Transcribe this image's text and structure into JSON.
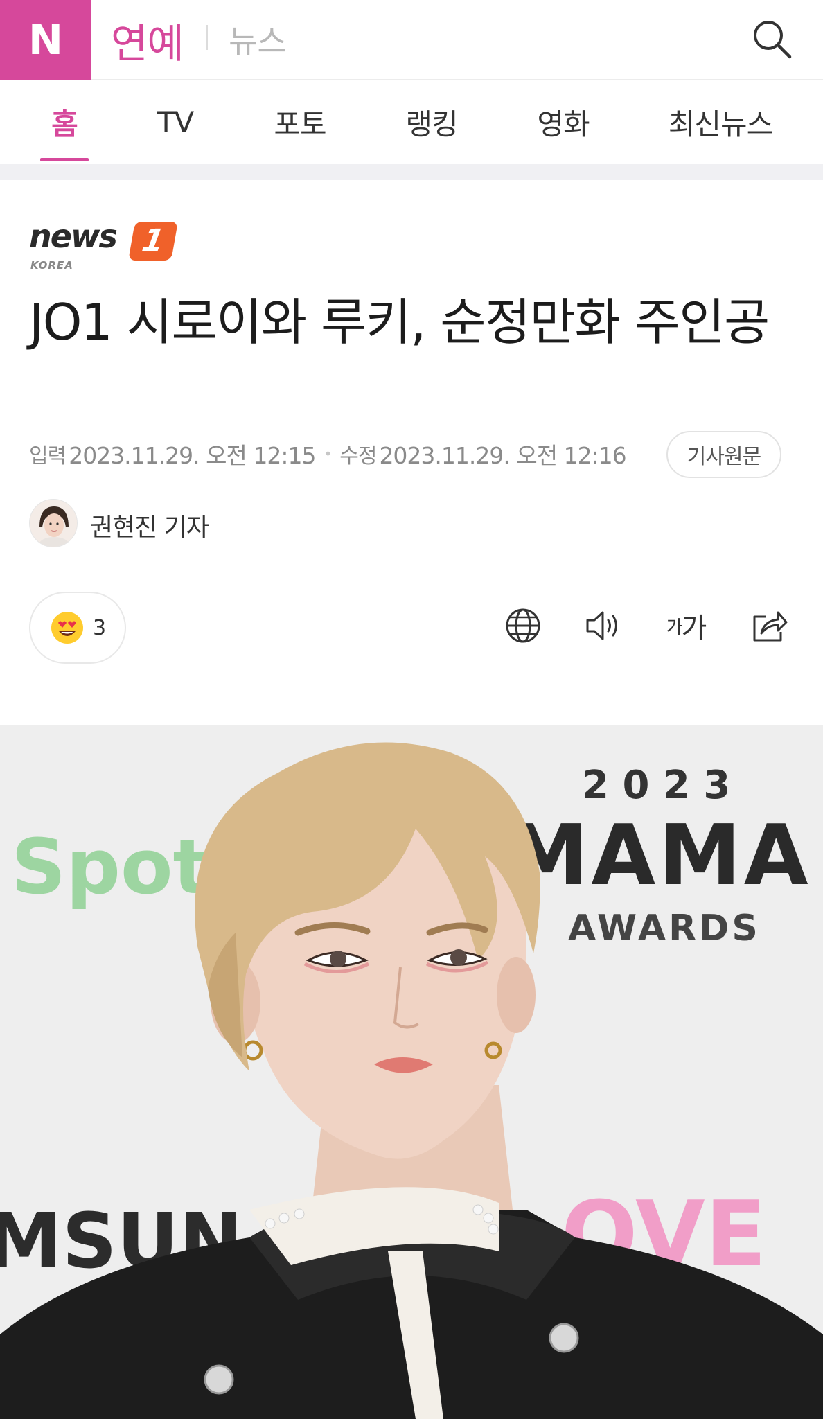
{
  "header": {
    "logo": "N",
    "section": "연예",
    "subsection": "뉴스",
    "search_icon": "search-icon"
  },
  "tabs": [
    {
      "label": "홈",
      "active": true
    },
    {
      "label": "TV",
      "active": false
    },
    {
      "label": "포토",
      "active": false
    },
    {
      "label": "랭킹",
      "active": false
    },
    {
      "label": "영화",
      "active": false
    },
    {
      "label": "최신뉴스",
      "active": false
    }
  ],
  "press": {
    "name": "news",
    "badge": "1",
    "sub": "KOREA",
    "badge_color": "#f0612a"
  },
  "article": {
    "headline": "JO1 시로이와 루키, 순정만화 주인공",
    "input_label": "입력",
    "input_date": "2023.11.29. 오전 12:15",
    "modified_label": "수정",
    "modified_date": "2023.11.29. 오전 12:16",
    "original_button": "기사원문",
    "reporter": "권현진 기자"
  },
  "actions": {
    "reaction_icon": "heart-eyes-emoji-icon",
    "reaction_count": "3",
    "translate_icon": "globe-icon",
    "tts_icon": "speaker-icon",
    "font_small": "가",
    "font_large": "가",
    "share_icon": "share-icon"
  },
  "photo": {
    "backdrop_year": "2 0 2 3",
    "backdrop_logo": "MAMA",
    "backdrop_awards": "AWARDS",
    "backdrop_sponsor": "Spoti",
    "backdrop_samsung": "MSUN",
    "backdrop_love": "OVE"
  },
  "colors": {
    "accent": "#d6489b",
    "tab_active": "#d6489b"
  }
}
